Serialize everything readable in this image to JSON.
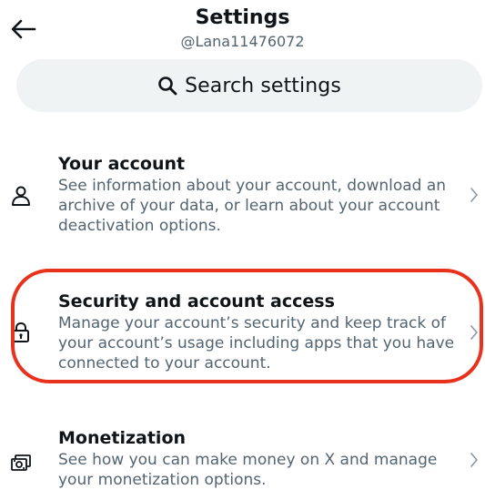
{
  "header": {
    "title": "Settings",
    "handle": "@Lana11476072",
    "back_icon": "arrow-left-icon"
  },
  "search": {
    "placeholder": "Search settings",
    "icon": "search-icon"
  },
  "items": [
    {
      "title": "Your account",
      "description": "See information about your account, download an archive of your data, or learn about your account deactivation options.",
      "icon": "person-icon"
    },
    {
      "title": "Security and account access",
      "description": "Manage your account’s security and keep track of your account’s usage including apps that you have connected to your account.",
      "icon": "lock-icon",
      "highlighted": true
    },
    {
      "title": "Monetization",
      "description": "See how you can make money on X and manage your monetization options.",
      "icon": "money-icon"
    }
  ],
  "colors": {
    "text": "#0f1419",
    "secondary": "#536471",
    "search_bg": "#eff3f4",
    "highlight": "#e8321e"
  }
}
